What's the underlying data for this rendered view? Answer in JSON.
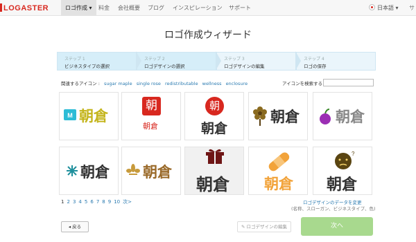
{
  "brand": {
    "name": "LOGASTER"
  },
  "nav": {
    "items": [
      {
        "label": "ロゴ作成 ▾"
      },
      {
        "label": "料金"
      },
      {
        "label": "会社概要"
      },
      {
        "label": "ブログ"
      },
      {
        "label": "インスピレーション"
      },
      {
        "label": "サポート"
      }
    ],
    "language": "日本語 ▾",
    "cutoff": "サ"
  },
  "page": {
    "title": "ロゴ作成ウィザード"
  },
  "steps": [
    {
      "num": "ステップ 1",
      "label": "ビジネスタイプの選択"
    },
    {
      "num": "ステップ 2",
      "label": "ロゴデザインの選択"
    },
    {
      "num": "ステップ 3",
      "label": "ロゴデザインの編集"
    },
    {
      "num": "ステップ 4",
      "label": "ロゴの保存"
    }
  ],
  "related": {
    "label": "関連するアイコン :",
    "tags": [
      "sugar maple",
      "single rose",
      "redistributable",
      "wellness",
      "enclosure"
    ]
  },
  "icon_search": {
    "label": "アイコンを検索する :",
    "value": ""
  },
  "logos": [
    {
      "text": "朝倉",
      "icon": "mt-badge-icon"
    },
    {
      "text": "朝倉",
      "icon": "red-kanji-square-icon"
    },
    {
      "text": "朝倉",
      "icon": "red-kanji-circle-icon"
    },
    {
      "text": "朝倉",
      "icon": "flower-icon"
    },
    {
      "text": "朝倉",
      "icon": "apple-icon"
    },
    {
      "text": "朝倉",
      "icon": "snowflake-icon"
    },
    {
      "text": "朝倉",
      "icon": "fleur-de-lis-icon"
    },
    {
      "text": "朝倉",
      "icon": "gift-box-icon"
    },
    {
      "text": "朝倉",
      "icon": "bandage-icon"
    },
    {
      "text": "朝倉",
      "icon": "confused-face-icon"
    }
  ],
  "pagination": {
    "pages": [
      "1",
      "2",
      "3",
      "4",
      "5",
      "6",
      "7",
      "8",
      "9",
      "10"
    ],
    "next": "次>"
  },
  "change": {
    "link": "ロゴデザインのデータを変更",
    "note": "(名称、スローガン、ビジネスタイプ、色)"
  },
  "buttons": {
    "back": "戻る",
    "edit": "ロゴデザインの編集",
    "next": "次へ"
  },
  "colors": {
    "brand": "#d8281f",
    "link": "#2a7ab0",
    "next_button": "#a8d98e",
    "step_active": "#d6eef9"
  }
}
